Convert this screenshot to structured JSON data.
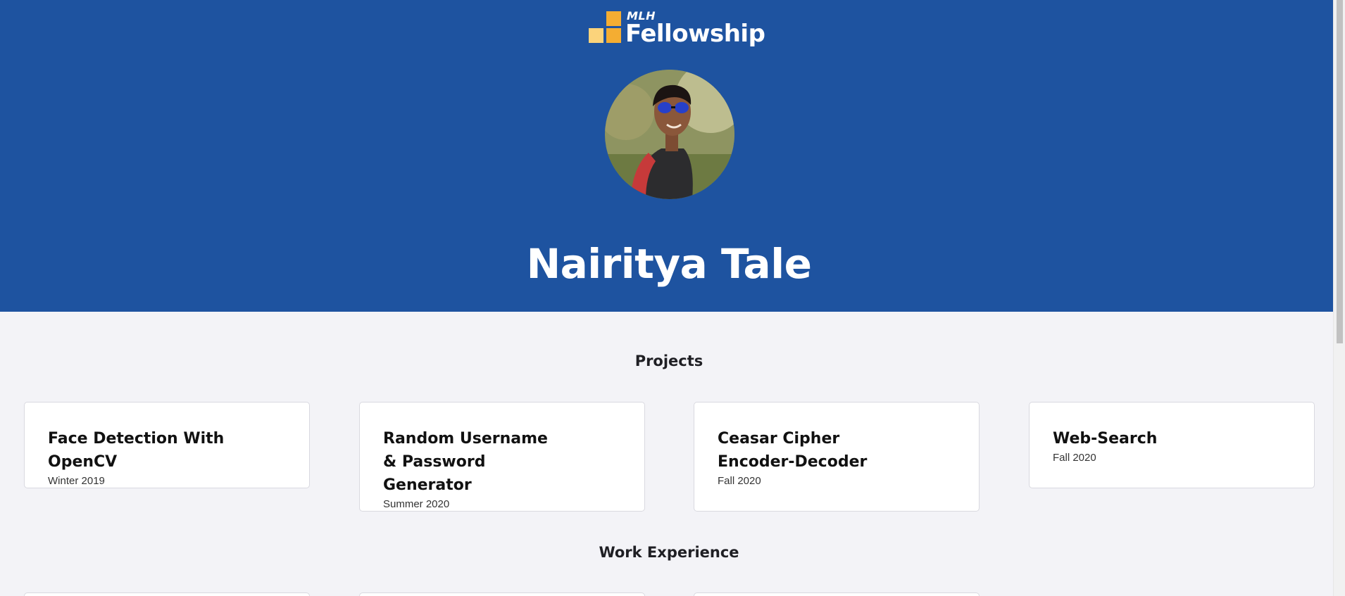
{
  "logo": {
    "mlh": "MLH",
    "text": "Fellowship"
  },
  "profile": {
    "name": "Nairitya Tale",
    "avatar_icon": "profile-photo"
  },
  "sections": {
    "projects_title": "Projects",
    "work_title": "Work Experience"
  },
  "projects": [
    {
      "title": "Face Detection With OpenCV",
      "term": "Winter 2019"
    },
    {
      "title": "Random Username & Password Generator",
      "term": "Summer 2020"
    },
    {
      "title": "Ceasar Cipher Encoder-Decoder",
      "term": "Fall 2020"
    },
    {
      "title": "Web-Search",
      "term": "Fall 2020"
    }
  ],
  "colors": {
    "hero": "#1e53a0",
    "background": "#f3f3f7",
    "logo_dark": "#f4ad32",
    "logo_light": "#fbd37b"
  }
}
